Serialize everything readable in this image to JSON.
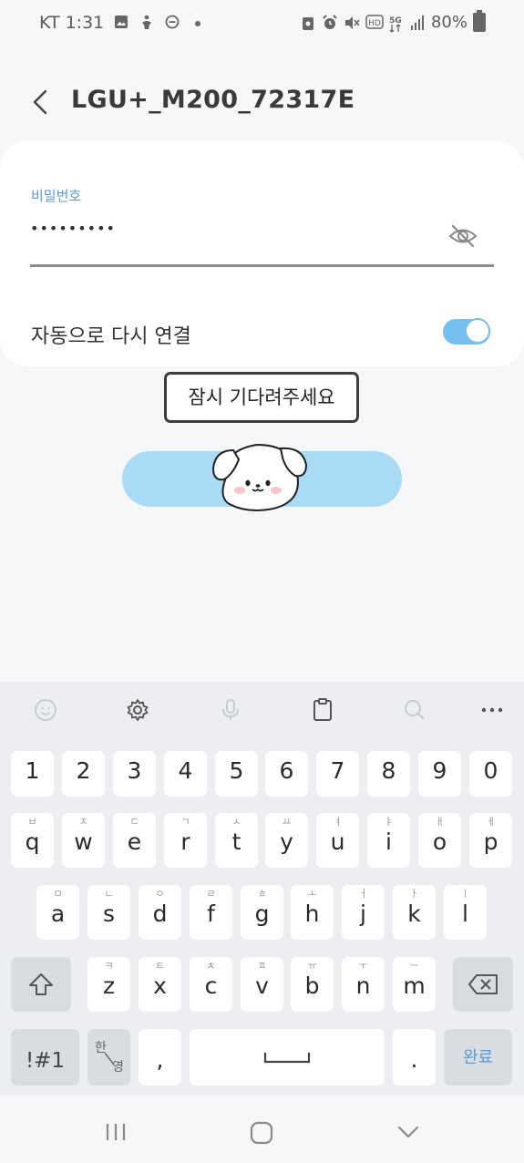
{
  "status_bar": {
    "carrier": "KT",
    "time": "1:31",
    "battery": "80%"
  },
  "header": {
    "title": "LGU+_M200_72317E"
  },
  "form": {
    "password_label": "비밀번호",
    "password_value": "•••••••••",
    "auto_reconnect_label": "자동으로 다시 연결",
    "auto_reconnect_on": true
  },
  "tooltip": {
    "text": "잠시 기다려주세요"
  },
  "keyboard": {
    "number_row": [
      "1",
      "2",
      "3",
      "4",
      "5",
      "6",
      "7",
      "8",
      "9",
      "0"
    ],
    "row1": [
      {
        "key": "q",
        "sub": "ㅂ"
      },
      {
        "key": "w",
        "sub": "ㅈ"
      },
      {
        "key": "e",
        "sub": "ㄷ"
      },
      {
        "key": "r",
        "sub": "ㄱ"
      },
      {
        "key": "t",
        "sub": "ㅅ"
      },
      {
        "key": "y",
        "sub": "ㅛ"
      },
      {
        "key": "u",
        "sub": "ㅕ"
      },
      {
        "key": "i",
        "sub": "ㅑ"
      },
      {
        "key": "o",
        "sub": "ㅐ"
      },
      {
        "key": "p",
        "sub": "ㅔ"
      }
    ],
    "row2": [
      {
        "key": "a",
        "sub": "ㅁ"
      },
      {
        "key": "s",
        "sub": "ㄴ"
      },
      {
        "key": "d",
        "sub": "ㅇ"
      },
      {
        "key": "f",
        "sub": "ㄹ"
      },
      {
        "key": "g",
        "sub": "ㅎ"
      },
      {
        "key": "h",
        "sub": "ㅗ"
      },
      {
        "key": "j",
        "sub": "ㅓ"
      },
      {
        "key": "k",
        "sub": "ㅏ"
      },
      {
        "key": "l",
        "sub": "ㅣ"
      }
    ],
    "row3": [
      {
        "key": "z",
        "sub": "ㅋ"
      },
      {
        "key": "x",
        "sub": "ㅌ"
      },
      {
        "key": "c",
        "sub": "ㅊ"
      },
      {
        "key": "v",
        "sub": "ㅍ"
      },
      {
        "key": "b",
        "sub": "ㅠ"
      },
      {
        "key": "n",
        "sub": "ㅜ"
      },
      {
        "key": "m",
        "sub": "ㅡ"
      }
    ],
    "symbols_label": "!#1",
    "lang_top": "한",
    "lang_bottom": "영",
    "comma": ",",
    "period": ".",
    "done_label": "완료"
  },
  "colors": {
    "accent": "#74bff0",
    "button": "#a9dbf6",
    "label_blue": "#5a9bd0"
  }
}
